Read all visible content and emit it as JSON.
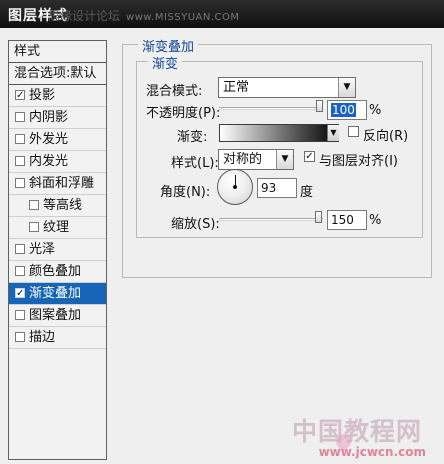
{
  "window": {
    "title": "图层样式",
    "top_watermark": "思缘设计论坛",
    "top_watermark_url": "www.MISSYUAN.COM"
  },
  "sidebar": {
    "header": "样式",
    "blend_options": "混合选项:默认",
    "items": [
      {
        "label": "投影",
        "checked": "✓"
      },
      {
        "label": "内阴影",
        "checked": ""
      },
      {
        "label": "外发光",
        "checked": ""
      },
      {
        "label": "内发光",
        "checked": ""
      },
      {
        "label": "斜面和浮雕",
        "checked": ""
      },
      {
        "label": "等高线",
        "checked": ""
      },
      {
        "label": "纹理",
        "checked": ""
      },
      {
        "label": "光泽",
        "checked": ""
      },
      {
        "label": "颜色叠加",
        "checked": ""
      },
      {
        "label": "渐变叠加",
        "checked": "✓"
      },
      {
        "label": "图案叠加",
        "checked": ""
      },
      {
        "label": "描边",
        "checked": ""
      }
    ]
  },
  "panel": {
    "group_title": "渐变叠加",
    "subgroup_title": "渐变",
    "blend_mode_label": "混合模式:",
    "blend_mode_value": "正常",
    "opacity_label": "不透明度(P):",
    "opacity_value": "100",
    "opacity_unit": "%",
    "gradient_label": "渐变:",
    "reverse_label": "反向(R)",
    "reverse_checked": "",
    "style_label": "样式(L):",
    "style_value": "对称的",
    "align_label": "与图层对齐(I)",
    "align_checked": "✓",
    "angle_label": "角度(N):",
    "angle_value": "93",
    "angle_unit": "度",
    "scale_label": "缩放(S):",
    "scale_value": "150",
    "scale_unit": "%"
  },
  "footer_watermark": {
    "main": "中国教程网",
    "url": "www.jcwcn.com"
  },
  "icons": {
    "dropdown": "chevron-down-icon",
    "checkbox": "checkmark-icon",
    "dial": "angle-dial-icon"
  },
  "colors": {
    "selection": "#1665b7",
    "title_bar": "#111111",
    "group_title": "#12479a",
    "highlight": "#1b62c6"
  }
}
